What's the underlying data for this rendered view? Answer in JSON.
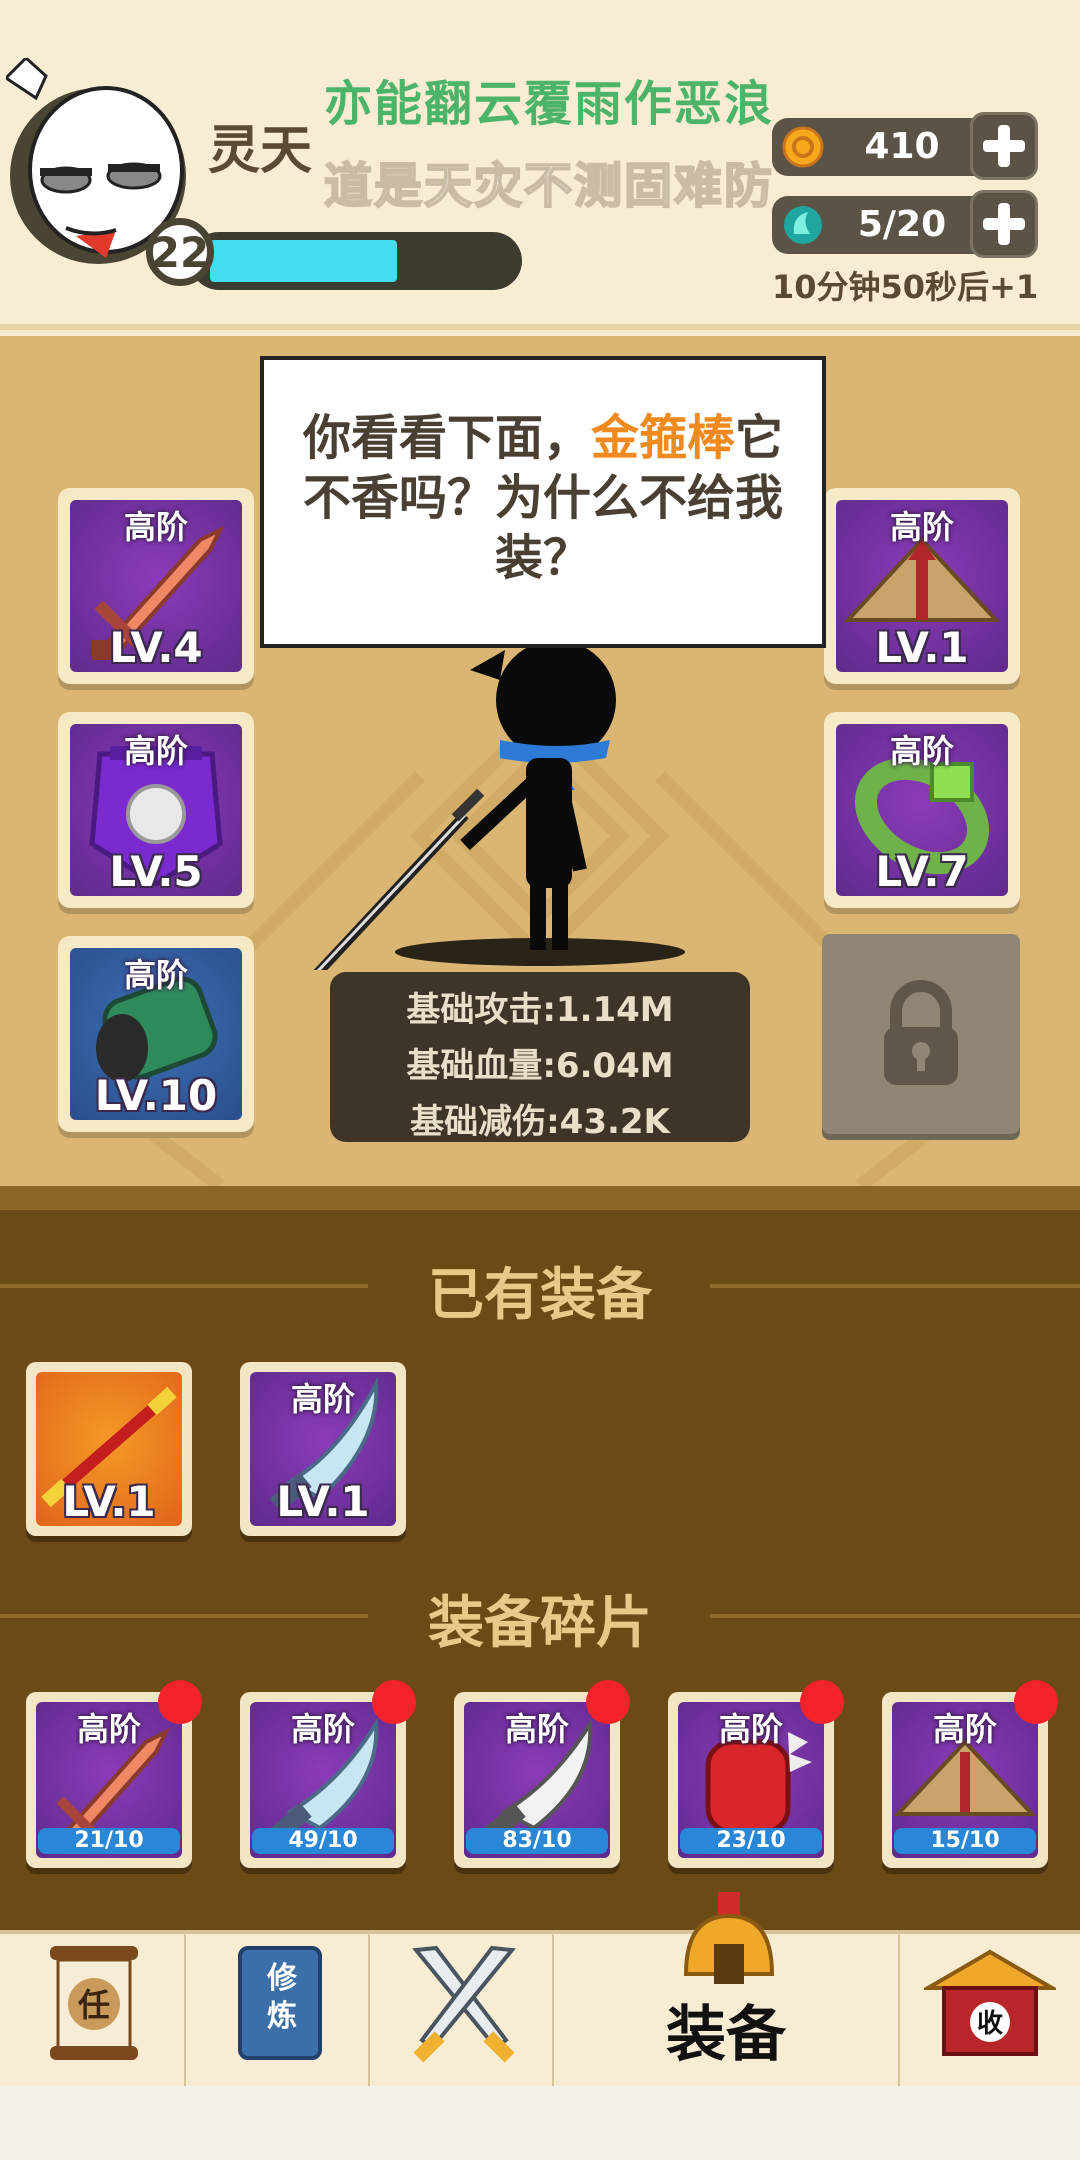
{
  "player": {
    "name": "灵天",
    "level": "22",
    "xp_fraction": 0.62,
    "motto_line1": "亦能翻云覆雨作恶浪",
    "motto_line2": "道是天灾不测固难防"
  },
  "resources": {
    "coins": "410",
    "energy": "5/20",
    "regen_text": "10分钟50秒后+1"
  },
  "speech": {
    "before": "你看看下面，",
    "highlight": "金箍棒",
    "after": "它不香吗？为什么不给我装？"
  },
  "equipped": {
    "left": [
      {
        "tier": "高阶",
        "level": "LV.4",
        "icon": "sword-icon"
      },
      {
        "tier": "高阶",
        "level": "LV.5",
        "icon": "armor-icon"
      },
      {
        "tier": "高阶",
        "level": "LV.10",
        "icon": "bracer-icon"
      }
    ],
    "right": [
      {
        "tier": "高阶",
        "level": "LV.1",
        "icon": "straw-hat-icon"
      },
      {
        "tier": "高阶",
        "level": "LV.7",
        "icon": "ring-icon"
      }
    ],
    "locked_slot_icon": "lock-icon"
  },
  "stats": {
    "attack": "基础攻击:1.14M",
    "hp": "基础血量:6.04M",
    "reduction": "基础减伤:43.2K"
  },
  "owned": {
    "title": "已有装备",
    "items": [
      {
        "tier": "",
        "level": "LV.1",
        "icon": "golden-staff-icon"
      },
      {
        "tier": "高阶",
        "level": "LV.1",
        "icon": "broadsword-icon"
      }
    ]
  },
  "fragments": {
    "title": "装备碎片",
    "items": [
      {
        "tier": "高阶",
        "progress": "21/10",
        "icon": "sword-icon"
      },
      {
        "tier": "高阶",
        "progress": "49/10",
        "icon": "broadsword-icon"
      },
      {
        "tier": "高阶",
        "progress": "83/10",
        "icon": "broadsword-icon"
      },
      {
        "tier": "高阶",
        "progress": "23/10",
        "icon": "gauntlet-icon"
      },
      {
        "tier": "高阶",
        "progress": "15/10",
        "icon": "straw-hat-icon"
      }
    ]
  },
  "tabs": {
    "task_glyph": "任",
    "cultivate_glyph": "修炼",
    "battle_icon": "crossed-swords-icon",
    "equip_label": "装备",
    "shop_glyph": "收"
  },
  "colors": {
    "accent_green": "#4bb36a",
    "highlight_orange": "#f08a1e",
    "xp_cyan": "#43ddee",
    "panel_brown": "#6b4a16"
  }
}
